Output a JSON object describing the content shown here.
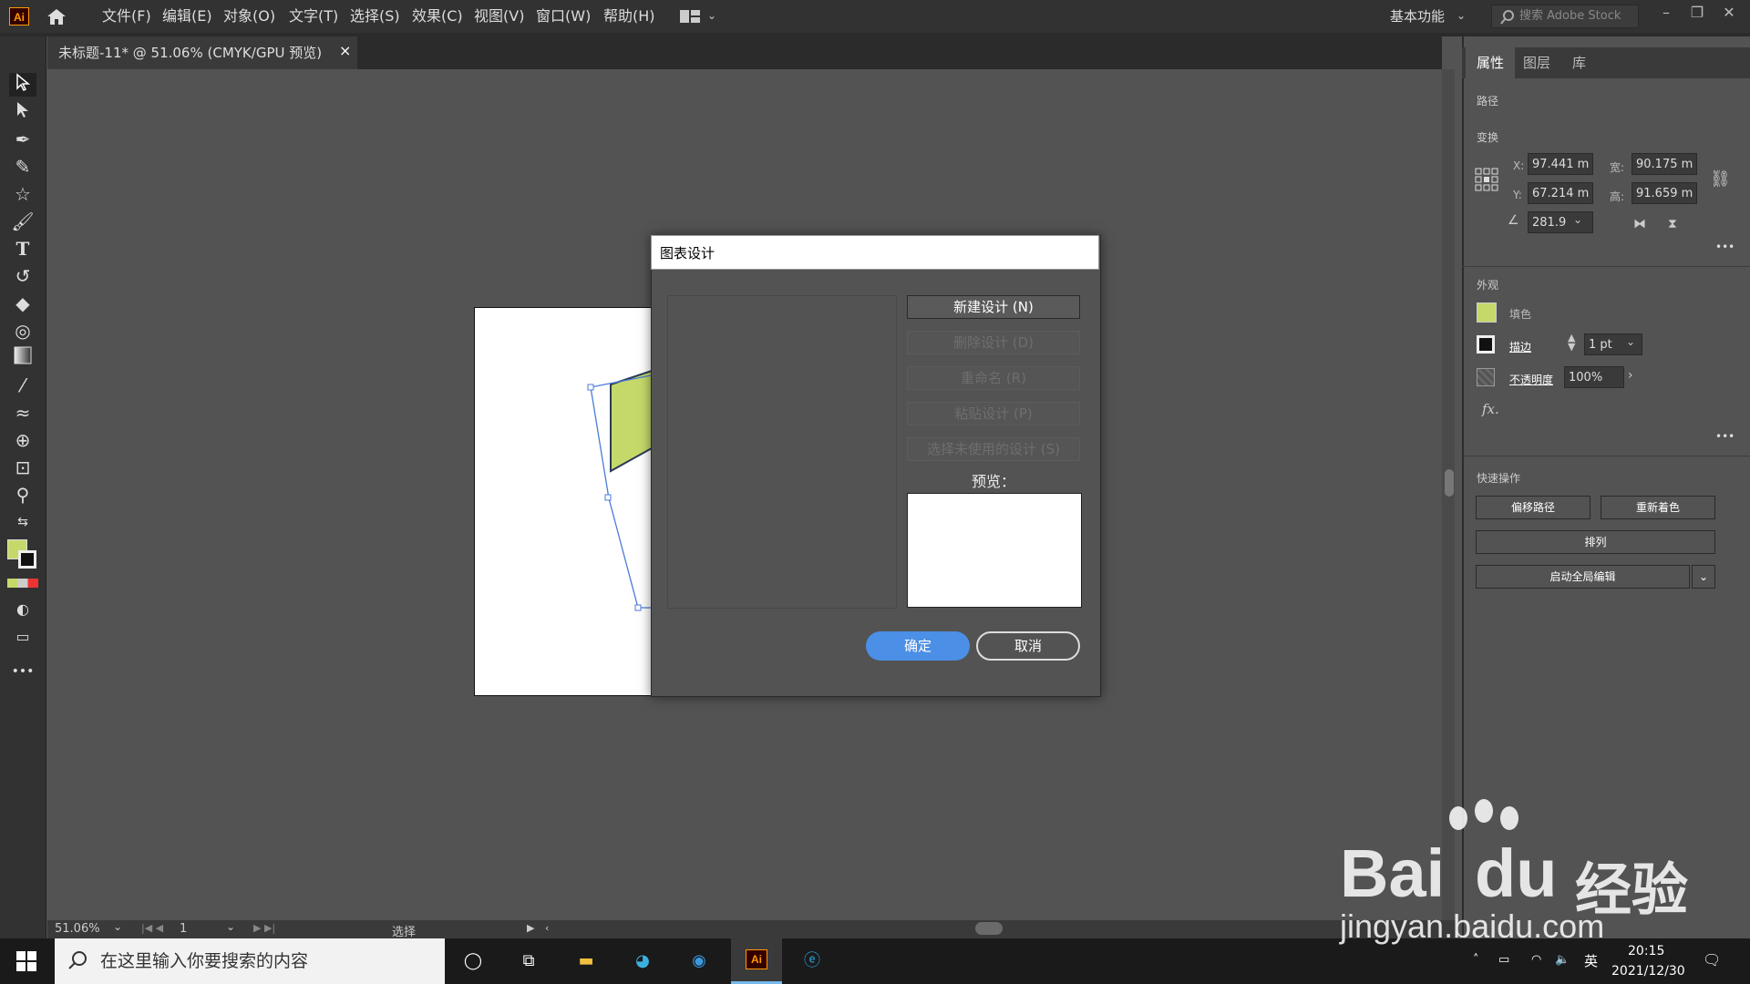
{
  "app": {
    "logo_text": "Ai",
    "menu": [
      "文件(F)",
      "编辑(E)",
      "对象(O)",
      "文字(T)",
      "选择(S)",
      "效果(C)",
      "视图(V)",
      "窗口(W)",
      "帮助(H)"
    ],
    "workspace": "基本功能",
    "stock_search_placeholder": "搜索 Adobe Stock",
    "colors": {
      "accent": "#4c8fe6",
      "fill_swatch": "#c5d96b",
      "logo": "#ff9a00"
    }
  },
  "document": {
    "tab_title": "未标题-11* @ 51.06% (CMYK/GPU 预览)",
    "close": "×"
  },
  "statusbar": {
    "zoom": "51.06%",
    "page": "1",
    "tool_name": "选择"
  },
  "panel": {
    "tabs": [
      "属性",
      "图层",
      "库"
    ],
    "object_type": "路径",
    "transform": {
      "title": "变换",
      "x_label": "X:",
      "x": "97.441 m",
      "y_label": "Y:",
      "y": "67.214 m",
      "w_label": "宽:",
      "w": "90.175 m",
      "h_label": "高:",
      "h": "91.659 m",
      "angle": "281.9"
    },
    "appearance": {
      "title": "外观",
      "fill_label": "填色",
      "stroke_label": "描边",
      "stroke_value": "1 pt",
      "opacity_label": "不透明度",
      "opacity_value": "100%",
      "fx": "fx."
    },
    "quick_actions": {
      "title": "快速操作",
      "offset_path": "偏移路径",
      "recolor": "重新着色",
      "arrange": "排列",
      "global_edit": "启动全局编辑"
    },
    "more": "•••"
  },
  "dialog": {
    "title": "图表设计",
    "buttons": {
      "new": "新建设计 (N)",
      "delete": "删除设计 (D)",
      "rename": "重命名 (R)",
      "paste": "粘贴设计 (P)",
      "select_unused": "选择未使用的设计 (S)"
    },
    "preview_label": "预览：",
    "ok": "确定",
    "cancel": "取消"
  },
  "taskbar": {
    "search_placeholder": "在这里输入你要搜索的内容",
    "time": "20:15",
    "date": "2021/12/30",
    "ime": "英"
  },
  "watermark": {
    "brand": "Bai",
    "brand2": "du",
    "cn": "经验",
    "url": "jingyan.baidu.com"
  }
}
